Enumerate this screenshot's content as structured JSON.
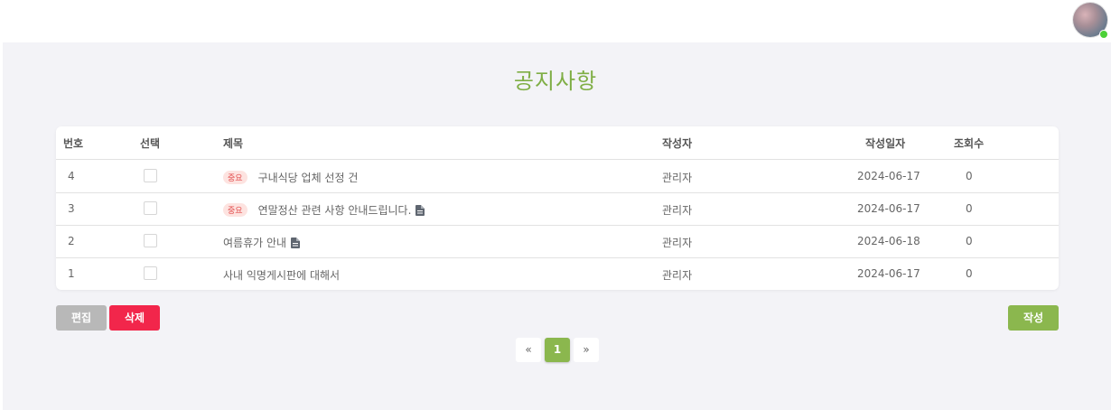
{
  "page": {
    "title": "공지사항"
  },
  "table": {
    "headers": {
      "no": "번호",
      "select": "선택",
      "subject": "제목",
      "author": "작성자",
      "date": "작성일자",
      "views": "조회수"
    },
    "rows": [
      {
        "no": "4",
        "badge": "중요",
        "subject": "구내식당 업체 선정 건",
        "attachment": false,
        "author": "관리자",
        "date": "2024-06-17",
        "views": "0"
      },
      {
        "no": "3",
        "badge": "중요",
        "subject": "연말정산 관련 사항 안내드립니다.",
        "attachment": true,
        "author": "관리자",
        "date": "2024-06-17",
        "views": "0"
      },
      {
        "no": "2",
        "badge": "",
        "subject": "여름휴가 안내",
        "attachment": true,
        "author": "관리자",
        "date": "2024-06-18",
        "views": "0"
      },
      {
        "no": "1",
        "badge": "",
        "subject": "사내 익명게시판에 대해서",
        "attachment": false,
        "author": "관리자",
        "date": "2024-06-17",
        "views": "0"
      }
    ]
  },
  "actions": {
    "edit": "편집",
    "delete": "삭제",
    "write": "작성"
  },
  "pagination": {
    "prev": "«",
    "current": "1",
    "next": "»"
  },
  "colors": {
    "accent": "#8bb74e",
    "danger": "#f2264b",
    "title": "#7fae45",
    "badge_text": "#e34f4f",
    "badge_bg": "#fde3e0"
  },
  "icons": {
    "attachment": "document-icon",
    "user": "avatar",
    "status": "online-dot"
  }
}
